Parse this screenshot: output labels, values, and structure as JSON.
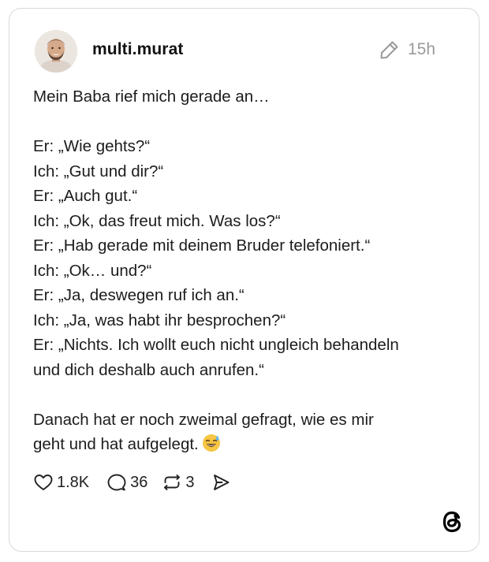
{
  "post": {
    "username": "multi.murat",
    "timestamp": "15h",
    "lines": [
      "Mein Baba rief mich gerade an…",
      "",
      "Er: „Wie gehts?“",
      "Ich: „Gut und dir?“",
      "Er: „Auch gut.“",
      "Ich: „Ok, das freut mich. Was los?“",
      "Er: „Hab gerade mit deinem Bruder telefoniert.“",
      "Ich: „Ok… und?“",
      "Er: „Ja, deswegen ruf ich an.“",
      "Ich: „Ja, was habt ihr besprochen?“",
      "Er: „Nichts. Ich wollt euch nicht ungleich behandeln",
      "und dich deshalb auch anrufen.“",
      "",
      "Danach hat er noch zweimal gefragt, wie es mir",
      "geht und hat aufgelegt."
    ],
    "emoji": "sweat-smile"
  },
  "actions": {
    "likes": "1.8K",
    "replies": "36",
    "reposts": "3"
  },
  "icons": {
    "edit": "pencil-icon",
    "like": "heart-icon",
    "reply": "speech-bubble-icon",
    "repost": "repost-icon",
    "share": "send-icon",
    "brand": "threads-logo"
  },
  "colors": {
    "text": "#1c1c1c",
    "muted": "#9a9a9a",
    "border": "#d9d9d9"
  }
}
